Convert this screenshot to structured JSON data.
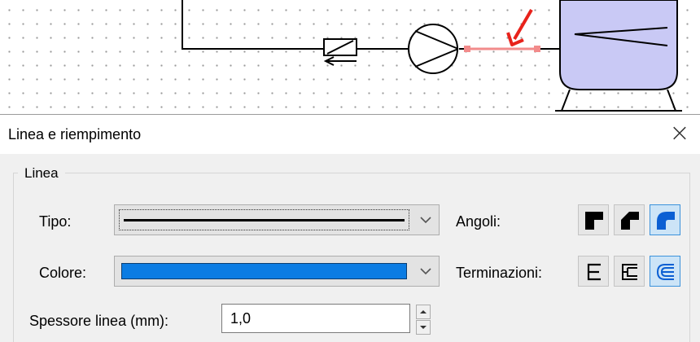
{
  "dialog": {
    "title": "Linea e riempimento",
    "close_symbol": "×",
    "group_label": "Linea"
  },
  "fields": {
    "tipo_label": "Tipo:",
    "colore_label": "Colore:",
    "spessore_label": "Spessore linea (mm):",
    "spessore_value": "1,0",
    "angoli_label": "Angoli:",
    "terminazioni_label": "Terminazioni:"
  },
  "colors": {
    "line_color_value": "#0b7ce3",
    "highlighted_pipe": "#f28b8b",
    "annotation_arrow": "#e8221b",
    "tank_fill": "#c9c9f5",
    "selected_button": "#cce4f7"
  },
  "icons": {
    "diagram": [
      "check-valve-symbol",
      "pump-symbol",
      "tank-symbol",
      "annotation-arrow"
    ],
    "angoli": [
      "corner-square-icon",
      "corner-bevel-icon",
      "corner-round-icon"
    ],
    "terminazioni": [
      "cap-butt-icon",
      "cap-square-icon",
      "cap-round-icon"
    ],
    "combo": "chevron-down-icon",
    "spin": [
      "spin-up-icon",
      "spin-down-icon"
    ]
  },
  "selection": {
    "angoli_selected": "corner-round",
    "terminazioni_selected": "cap-round"
  }
}
